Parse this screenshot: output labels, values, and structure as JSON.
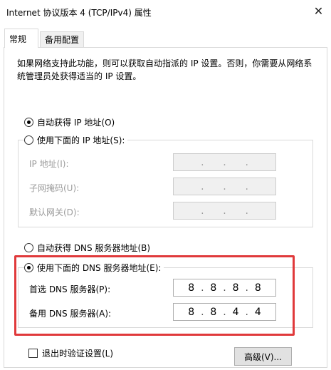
{
  "window": {
    "title": "Internet 协议版本 4 (TCP/IPv4) 属性",
    "close_glyph": "✕"
  },
  "tabs": [
    {
      "label": "常规",
      "active": true
    },
    {
      "label": "备用配置",
      "active": false
    }
  ],
  "description": "如果网络支持此功能，则可以获取自动指派的 IP 设置。否则，你需要从网络系统管理员处获得适当的 IP 设置。",
  "ip_section": {
    "auto_label": "自动获得 IP 地址(O)",
    "auto_selected": true,
    "manual_label": "使用下面的 IP 地址(S):",
    "manual_selected": false,
    "fields": [
      {
        "label": "IP 地址(I):",
        "octets": [
          "",
          "",
          "",
          ""
        ],
        "disabled": true
      },
      {
        "label": "子网掩码(U):",
        "octets": [
          "",
          "",
          "",
          ""
        ],
        "disabled": true
      },
      {
        "label": "默认网关(D):",
        "octets": [
          "",
          "",
          "",
          ""
        ],
        "disabled": true
      }
    ]
  },
  "dns_section": {
    "auto_label": "自动获得 DNS 服务器地址(B)",
    "auto_selected": false,
    "manual_label": "使用下面的 DNS 服务器地址(E):",
    "manual_selected": true,
    "fields": [
      {
        "label": "首选 DNS 服务器(P):",
        "octets": [
          "8",
          "8",
          "8",
          "8"
        ]
      },
      {
        "label": "备用 DNS 服务器(A):",
        "octets": [
          "8",
          "8",
          "4",
          "4"
        ]
      }
    ]
  },
  "validate_label": "退出时验证设置(L)",
  "validate_checked": false,
  "advanced_button": "高级(V)...",
  "highlight_color": "#e0393b"
}
